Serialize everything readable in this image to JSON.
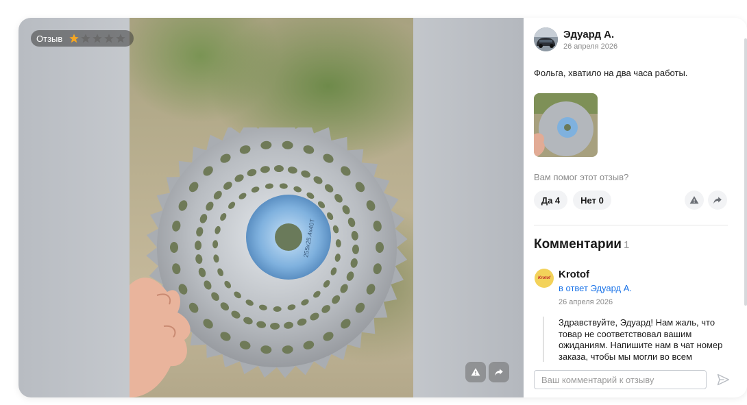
{
  "media": {
    "tag_label": "Отзыв",
    "rating": 1,
    "rating_max": 5,
    "star_color_on": "#f5a623",
    "star_color_off": "#6a6a6a",
    "blade_marking": "255x25.4x40T"
  },
  "review": {
    "author_name": "Эдуард А.",
    "date": "26 апреля 2026",
    "text": "Фольга, хватило на два часа работы.",
    "helpful_question": "Вам помог этот отзыв?",
    "vote_yes": "Да 4",
    "vote_no": "Нет 0"
  },
  "comments": {
    "title": "Комментарии",
    "count": "1",
    "items": [
      {
        "author": "Krotof",
        "avatar_text": "Krotof",
        "reply_to": "в ответ Эдуард А.",
        "date": "26 апреля 2026",
        "text": "Здравствуйте, Эдуард! Нам жаль, что товар не соответствовал вашим ожиданиям. Напишите нам в чат номер заказа, чтобы мы могли во всем"
      }
    ],
    "input_placeholder": "Ваш комментарий к отзыву"
  },
  "colors": {
    "link": "#1a73e8",
    "muted": "#8a8a8a",
    "chip_bg": "#f2f3f5"
  }
}
